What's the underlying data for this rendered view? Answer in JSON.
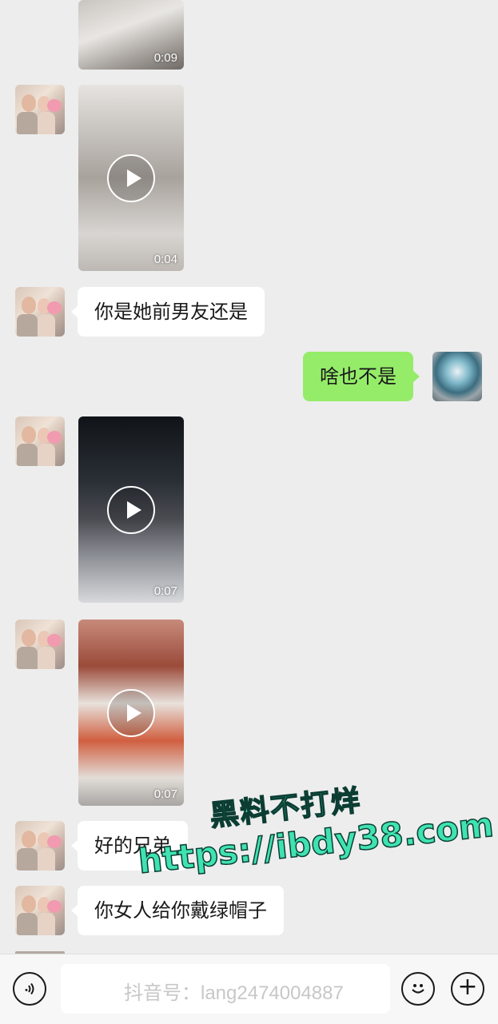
{
  "messages": [
    {
      "type": "video",
      "side": "left",
      "duration": "0:09"
    },
    {
      "type": "video",
      "side": "left",
      "duration": "0:04"
    },
    {
      "type": "text",
      "side": "left",
      "text": "你是她前男友还是"
    },
    {
      "type": "text",
      "side": "right",
      "text": "啥也不是"
    },
    {
      "type": "video",
      "side": "left",
      "duration": "0:07"
    },
    {
      "type": "video",
      "side": "left",
      "duration": "0:07"
    },
    {
      "type": "text",
      "side": "left",
      "text": "好的兄弟"
    },
    {
      "type": "text",
      "side": "left",
      "text": "你女人给你戴绿帽子"
    }
  ],
  "watermark": {
    "line1": "黑料不打烊",
    "line2": "https://ibdy38.com",
    "douyin": "抖音号：lang2474004887"
  },
  "input_bar": {
    "voice_icon": "voice-icon",
    "emoji_icon": "emoji-icon",
    "plus_icon": "plus-icon"
  },
  "colors": {
    "background": "#ededed",
    "sent_bubble": "#95ec69",
    "received_bubble": "#ffffff",
    "watermark": "#3fe3b1"
  }
}
